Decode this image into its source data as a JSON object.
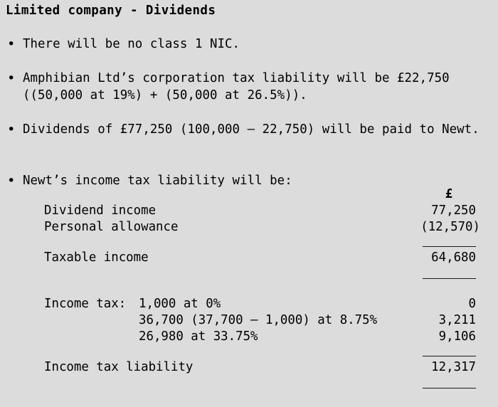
{
  "document": {
    "title": "Limited company - Dividends",
    "background_color": "#dcdcdc",
    "text_color": "#000000",
    "bullet_glyph": "•",
    "bullets": [
      {
        "id": "nic",
        "text": "There will be no class 1 NIC."
      },
      {
        "id": "corporation-tax",
        "text": "Amphibian Ltd’s corporation tax liability will be £22,750 ((50,000 at 19%) + (50,000 at 26.5%))."
      },
      {
        "id": "dividends-paid",
        "text": "Dividends of £77,250 (100,000 – 22,750) will be paid to Newt."
      },
      {
        "id": "income-tax-intro",
        "text": "Newt’s income tax liability will be:"
      }
    ],
    "schedule": {
      "currency_header": "£",
      "rows": [
        {
          "label": "Dividend income",
          "detail": "",
          "amount": "77,250",
          "paren": false
        },
        {
          "label": "Personal allowance",
          "detail": "",
          "amount": "(12,570)",
          "paren": true
        },
        {
          "label": "Taxable income",
          "detail": "",
          "amount": "64,680",
          "paren": false
        },
        {
          "label": "Income tax:",
          "detail": "1,000 at 0%",
          "amount": "0",
          "paren": false
        },
        {
          "label": "",
          "detail": "36,700 (37,700 – 1,000) at 8.75%",
          "amount": "3,211",
          "paren": false
        },
        {
          "label": "",
          "detail": "26,980 at 33.75%",
          "amount": "9,106",
          "paren": false
        },
        {
          "label": "Income tax liability",
          "detail": "",
          "amount": "12,317",
          "paren": false
        }
      ]
    }
  }
}
